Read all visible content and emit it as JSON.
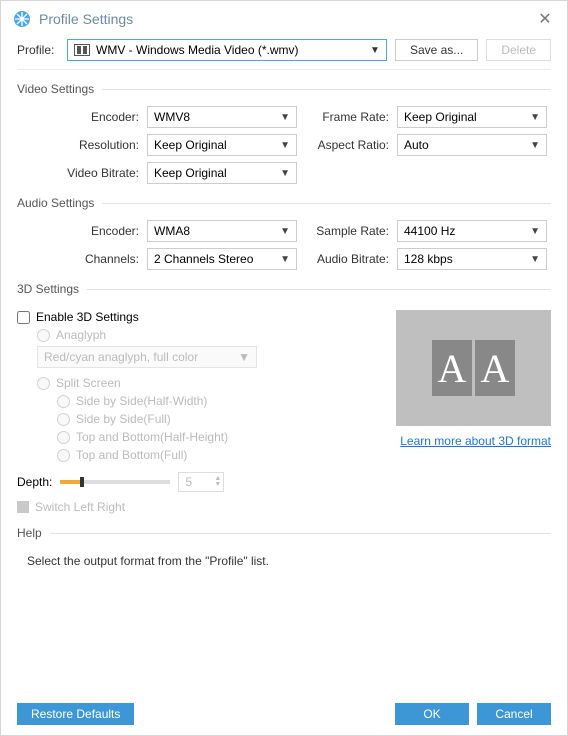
{
  "window": {
    "title": "Profile Settings"
  },
  "profile": {
    "label": "Profile:",
    "selected": "WMV - Windows Media Video (*.wmv)",
    "saveAs": "Save as...",
    "delete": "Delete"
  },
  "sections": {
    "video": "Video Settings",
    "audio": "Audio Settings",
    "threeD": "3D Settings",
    "help": "Help"
  },
  "video": {
    "encoderLabel": "Encoder:",
    "encoder": "WMV8",
    "resolutionLabel": "Resolution:",
    "resolution": "Keep Original",
    "bitrateLabel": "Video Bitrate:",
    "bitrate": "Keep Original",
    "frameRateLabel": "Frame Rate:",
    "frameRate": "Keep Original",
    "aspectLabel": "Aspect Ratio:",
    "aspect": "Auto"
  },
  "audio": {
    "encoderLabel": "Encoder:",
    "encoder": "WMA8",
    "channelsLabel": "Channels:",
    "channels": "2 Channels Stereo",
    "sampleLabel": "Sample Rate:",
    "sample": "44100 Hz",
    "bitrateLabel": "Audio Bitrate:",
    "bitrate": "128 kbps"
  },
  "threeD": {
    "enable": "Enable 3D Settings",
    "anaglyph": "Anaglyph",
    "anaglyphOption": "Red/cyan anaglyph, full color",
    "splitScreen": "Split Screen",
    "sideHalf": "Side by Side(Half-Width)",
    "sideFull": "Side by Side(Full)",
    "topHalf": "Top and Bottom(Half-Height)",
    "topFull": "Top and Bottom(Full)",
    "depthLabel": "Depth:",
    "depthValue": "5",
    "switchLR": "Switch Left Right",
    "learnMore": "Learn more about 3D format"
  },
  "help": {
    "text": "Select the output format from the \"Profile\" list."
  },
  "footer": {
    "restore": "Restore Defaults",
    "ok": "OK",
    "cancel": "Cancel"
  }
}
